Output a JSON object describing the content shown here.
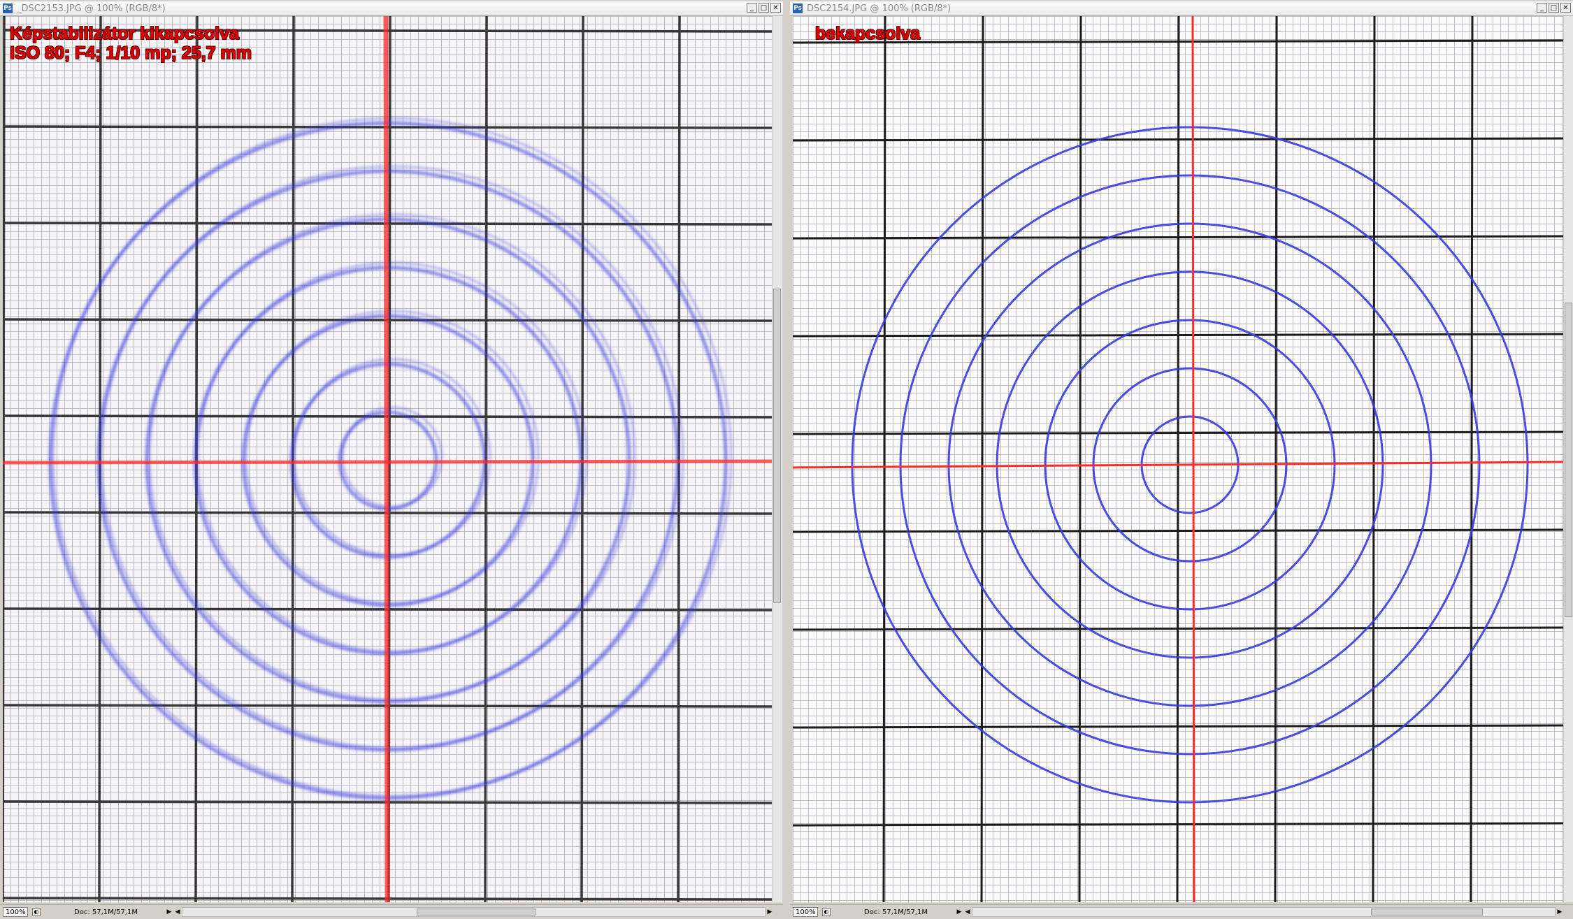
{
  "windows": [
    {
      "id": "left",
      "title": "_DSC2153.JPG @ 100% (RGB/8*)",
      "overlay_lines": [
        "Képstabilizátor kikapcsolva",
        "ISO 80; F4; 1/10 mp; 25,7 mm"
      ],
      "zoom": "100%",
      "doc_info": "Doc: 57,1M/57,1M",
      "image_state": "blurred"
    },
    {
      "id": "right",
      "title": "DSC2154.JPG @ 100% (RGB/8*)",
      "overlay_lines": [
        "bekapcsolva"
      ],
      "zoom": "100%",
      "doc_info": "Doc: 57,1M/57,1M",
      "image_state": "sharp"
    }
  ],
  "icons": {
    "app": "photoshop-icon",
    "minimize": "minimize-icon",
    "maximize": "maximize-icon",
    "close": "close-icon"
  },
  "colors": {
    "target_circles": "#3a3ae0",
    "crosshair": "#ff2a2a",
    "grid_major": "#1a1a1a",
    "grid_minor": "#a9a9b4",
    "overlay_text": "#e00000"
  }
}
